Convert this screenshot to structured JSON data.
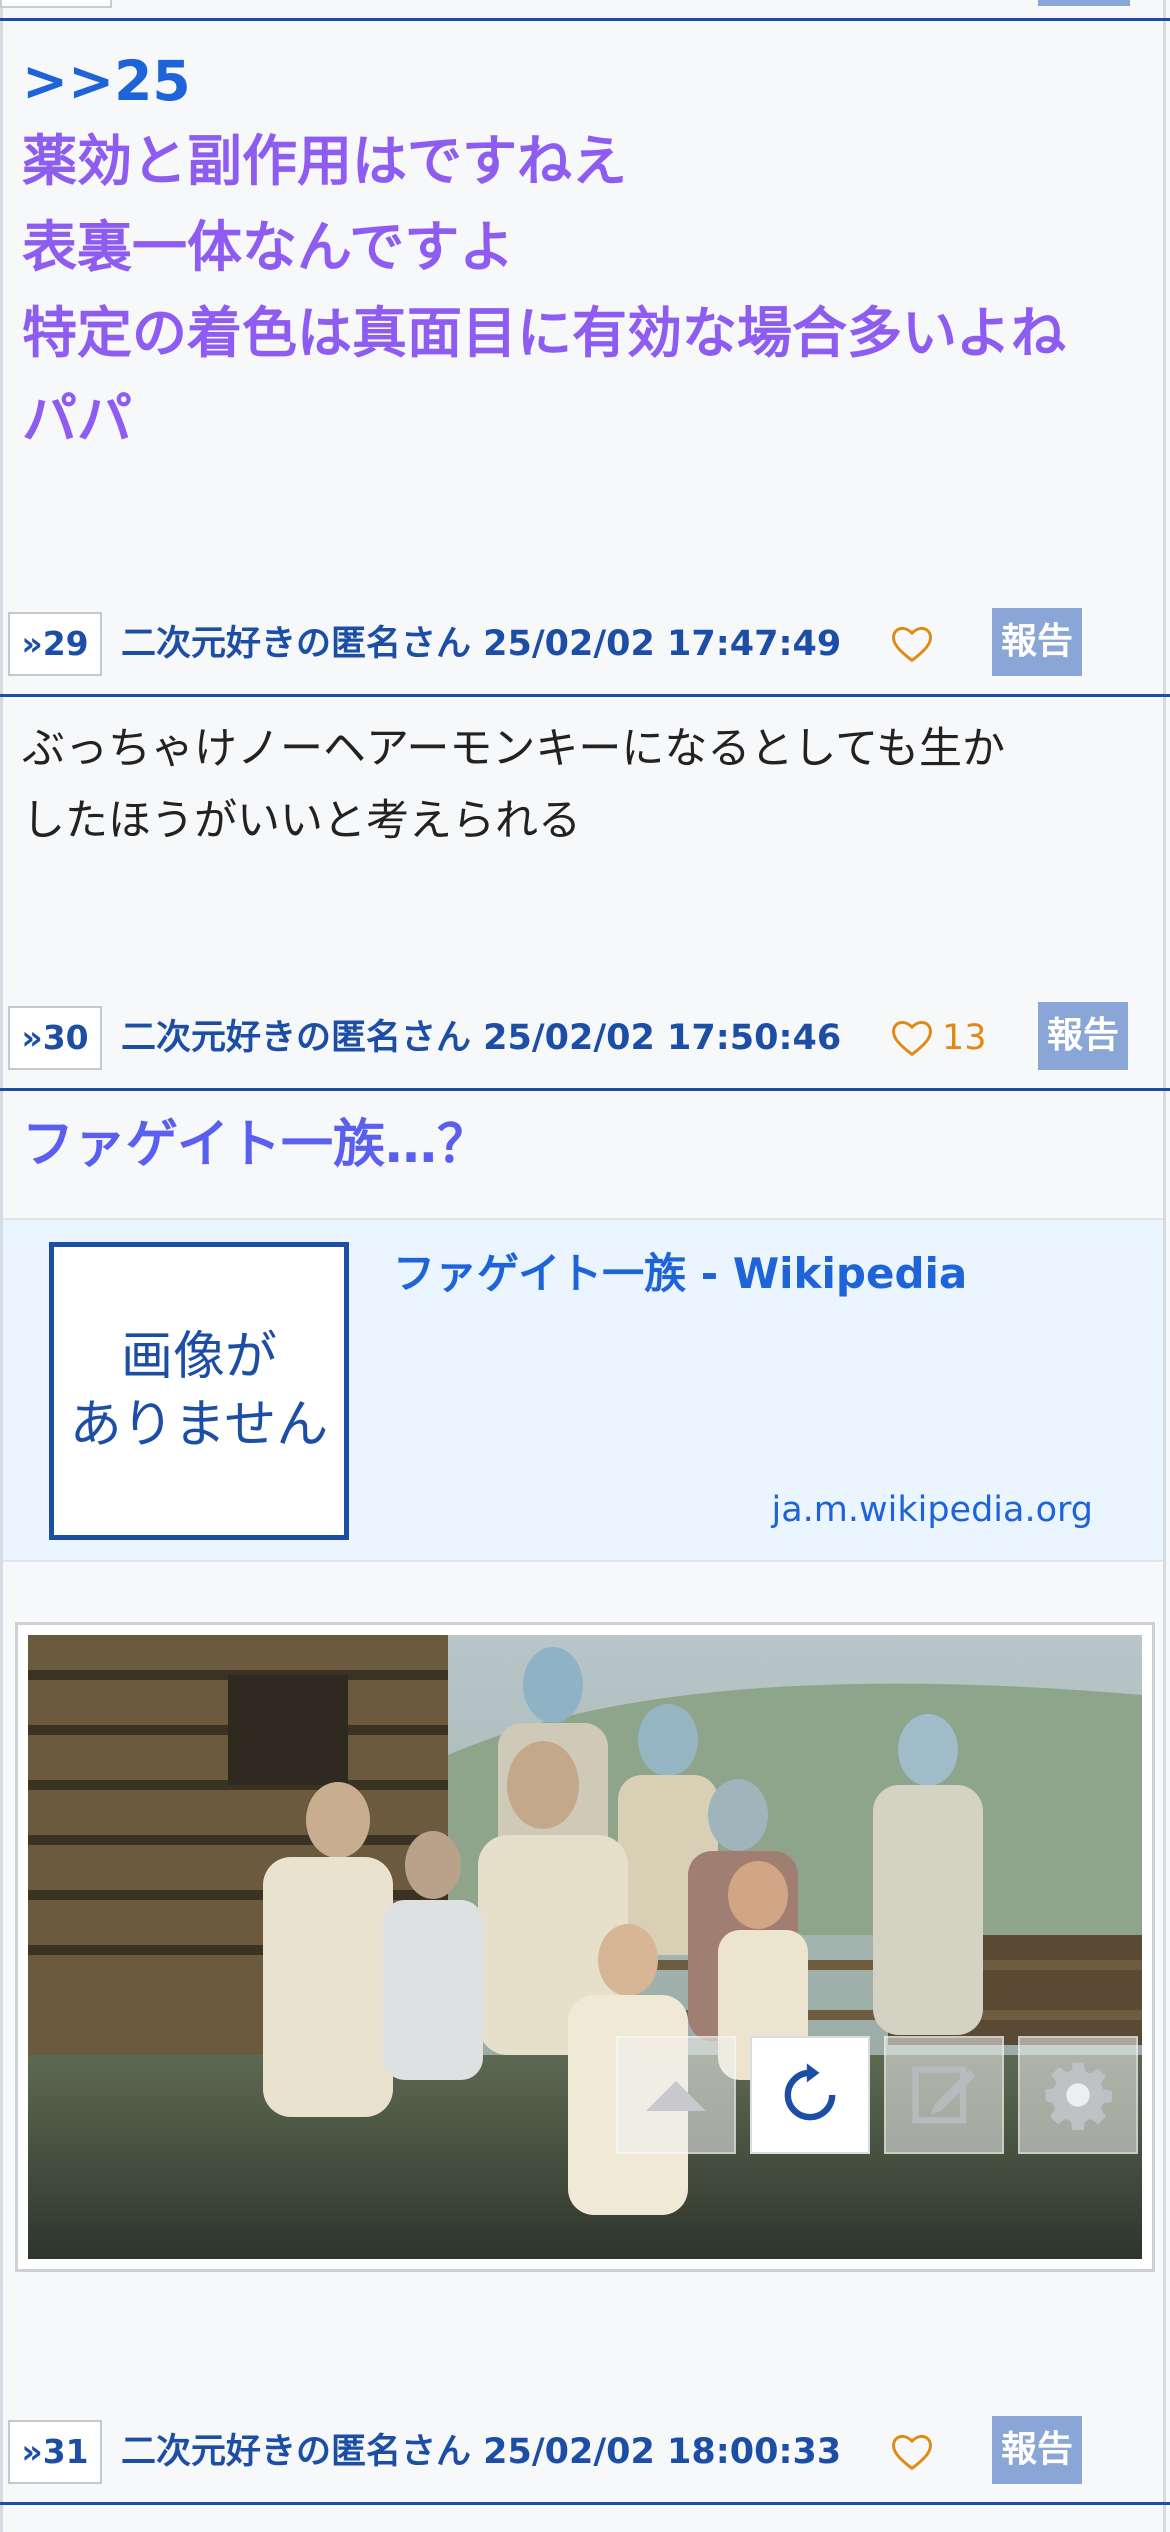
{
  "post28": {
    "anchor": ">>25",
    "lines": [
      "薬効と副作用はですねえ",
      "表裏一体なんですよ",
      "特定の着色は真面目に有効な場合多いよね",
      "パパ"
    ]
  },
  "post29_meta": {
    "num": "29",
    "poster": "二次元好きの匿名さん 25/02/02 17:47:49",
    "likes": "",
    "report": "報告"
  },
  "post29": {
    "lines": [
      "ぶっちゃけノーヘアーモンキーになるとしても生か",
      "したほうがいいと考えられる"
    ]
  },
  "post30_meta": {
    "num": "30",
    "poster": "二次元好きの匿名さん 25/02/02 17:50:46",
    "likes": "13",
    "report": "報告"
  },
  "post30": {
    "title": "ファゲイト一族…？",
    "link": {
      "no_image_line1": "画像が",
      "no_image_line2": "ありません",
      "title": "ファゲイト一族 - Wikipedia",
      "domain": "ja.m.wikipedia.org"
    },
    "image_controls": [
      "triangle-up-icon",
      "refresh-icon",
      "edit-icon",
      "gear-icon"
    ]
  },
  "post31_meta": {
    "num": "31",
    "poster": "二次元好きの匿名さん 25/02/02 18:00:33",
    "likes": "",
    "report": "報告"
  },
  "colors": {
    "accent": "#1c4ea6",
    "purple": "#8e5cf0",
    "like": "#e08a14",
    "report": "#8aa6d6"
  }
}
